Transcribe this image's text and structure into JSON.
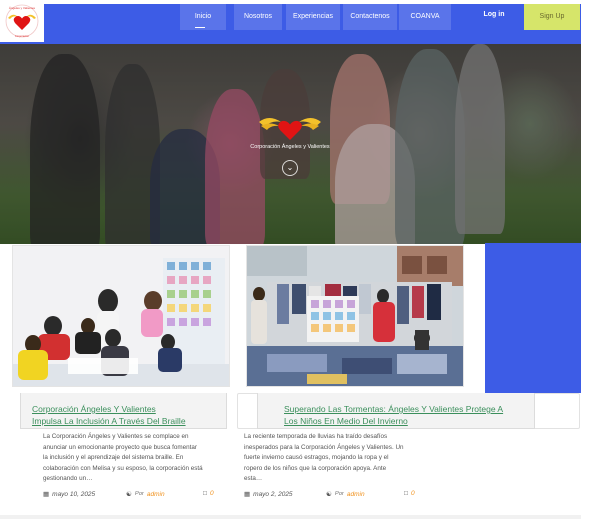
{
  "header": {
    "logo_icon": "heart-wings-logo",
    "nav": [
      {
        "label": "Inicio",
        "active": true
      },
      {
        "label": "Nosotros"
      },
      {
        "label": "Experiencias"
      },
      {
        "label": "Contactenos"
      },
      {
        "label": "COANVA"
      }
    ],
    "login": "Log in",
    "signup": "Sign Up"
  },
  "hero": {
    "brand_title": "Corporación Ángeles y Valientes",
    "brand_icon": "heart-wings-icon",
    "scroll_icon": "chevron-down-icon"
  },
  "posts": [
    {
      "title_line1": "Corporación Ángeles Y Valientes",
      "title_line2": "Impulsa La Inclusión A Través Del Braille",
      "excerpt": [
        "La Corporación Ángeles y Valientes se complace en",
        "anunciar un emocionante proyecto que busca fomentar",
        "la inclusión y el aprendizaje del sistema braille. En",
        "colaboración con Melisa y su esposo, la corporación está",
        "gestionando un…"
      ],
      "date": "mayo 10, 2025",
      "by": "Por",
      "author": "admin",
      "comments": "0"
    },
    {
      "title_line1": "Superando Las Tormentas: Ángeles Y Valientes Protege A",
      "title_line2": "Los Niños En Medio Del Invierno",
      "excerpt": [
        "La reciente temporada de lluvias ha traído desafíos",
        "inesperados para la Corporación Ángeles y Valientes. Un",
        "fuerte invierno causó estragos, mojando la ropa y el",
        "ropero de los niños que la corporación apoya. Ante",
        "esta…"
      ],
      "date": "mayo 2, 2025",
      "by": "Por",
      "author": "admin",
      "comments": "0"
    }
  ],
  "colors": {
    "primary_blue": "#3d5ce6",
    "nav_button": "#5a74ea",
    "signup": "#d6e56a",
    "title_green": "#3b8f5c",
    "author_orange": "#f0921e",
    "heart_red": "#e01414"
  }
}
